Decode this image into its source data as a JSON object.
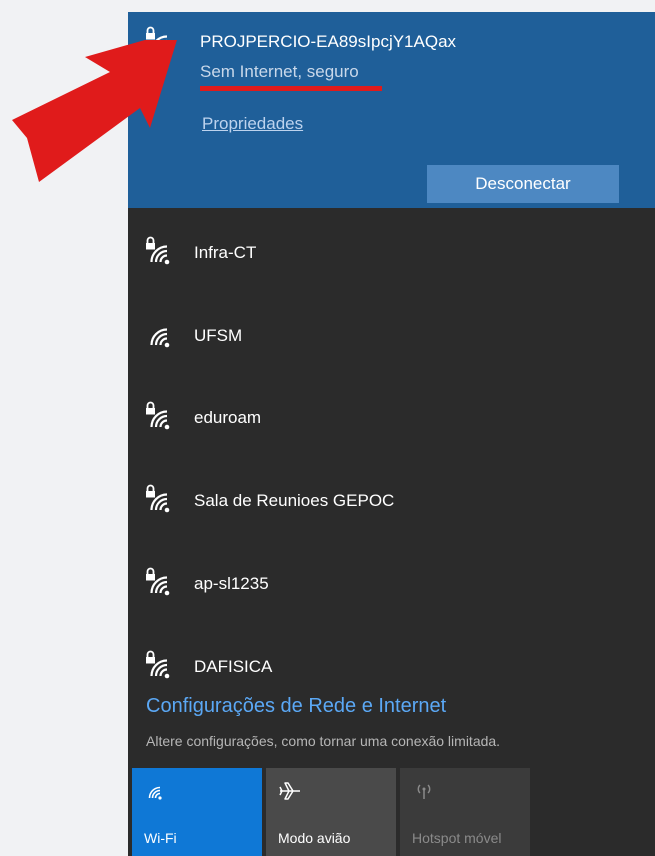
{
  "connected_network": {
    "name": "PROJPERCIO-EA89sIpcjY1AQax",
    "status": "Sem Internet, seguro",
    "properties_link": "Propriedades",
    "disconnect_button": "Desconectar",
    "icon": "wifi-secured-icon"
  },
  "networks": [
    {
      "name": "Infra-CT",
      "secured": true,
      "icon": "wifi-secured-icon"
    },
    {
      "name": "UFSM",
      "secured": false,
      "icon": "wifi-icon"
    },
    {
      "name": "eduroam",
      "secured": true,
      "icon": "wifi-secured-icon"
    },
    {
      "name": "Sala de Reunioes GEPOC",
      "secured": true,
      "icon": "wifi-secured-icon"
    },
    {
      "name": "ap-sl1235",
      "secured": true,
      "icon": "wifi-secured-icon"
    },
    {
      "name": "DAFISICA",
      "secured": true,
      "icon": "wifi-secured-icon"
    }
  ],
  "settings": {
    "link": "Configurações de Rede e Internet",
    "description": "Altere configurações, como tornar uma conexão limitada."
  },
  "quick_actions": [
    {
      "label": "Wi-Fi",
      "icon": "wifi-icon",
      "active": true
    },
    {
      "label": "Modo avião",
      "icon": "airplane-icon",
      "active": false
    },
    {
      "label": "Hotspot móvel",
      "icon": "hotspot-icon",
      "active": false,
      "disabled": true
    }
  ],
  "colors": {
    "page_background": "#f1f2f4",
    "panel_background": "#2b2b2b",
    "connected_background": "#1f5f99",
    "disconnect_button": "#4d88c2",
    "settings_link": "#5ba8f5",
    "active_tile": "#0f78d6",
    "annotation_red": "#e01b1b"
  }
}
